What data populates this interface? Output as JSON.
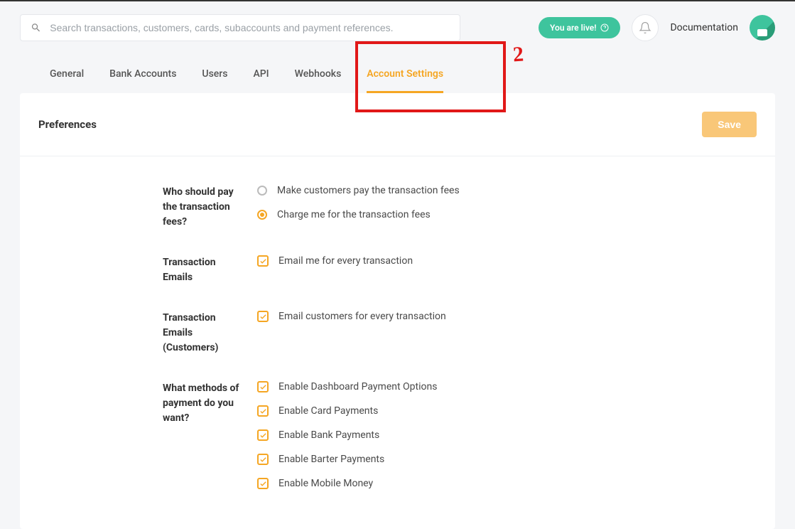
{
  "header": {
    "search_placeholder": "Search transactions, customers, cards, subaccounts and payment references.",
    "live_badge": "You are live!",
    "doc_link": "Documentation"
  },
  "tabs": {
    "general": "General",
    "bank_accounts": "Bank Accounts",
    "users": "Users",
    "api": "API",
    "webhooks": "Webhooks",
    "account_settings": "Account Settings"
  },
  "annotation": {
    "marker": "2"
  },
  "panel": {
    "title": "Preferences",
    "save_label": "Save"
  },
  "preferences": {
    "fees": {
      "label": "Who should pay the transaction fees?",
      "option_customer": "Make customers pay the transaction fees",
      "option_me": "Charge me for the transaction fees"
    },
    "tx_emails": {
      "label": "Transaction Emails",
      "option": "Email me for every transaction"
    },
    "tx_emails_customers": {
      "label": "Transaction Emails (Customers)",
      "option": "Email customers for every transaction"
    },
    "payment_methods": {
      "label": "What methods of payment do you want?",
      "dashboard": "Enable Dashboard Payment Options",
      "card": "Enable Card Payments",
      "bank": "Enable Bank Payments",
      "barter": "Enable Barter Payments",
      "mobile": "Enable Mobile Money"
    }
  }
}
